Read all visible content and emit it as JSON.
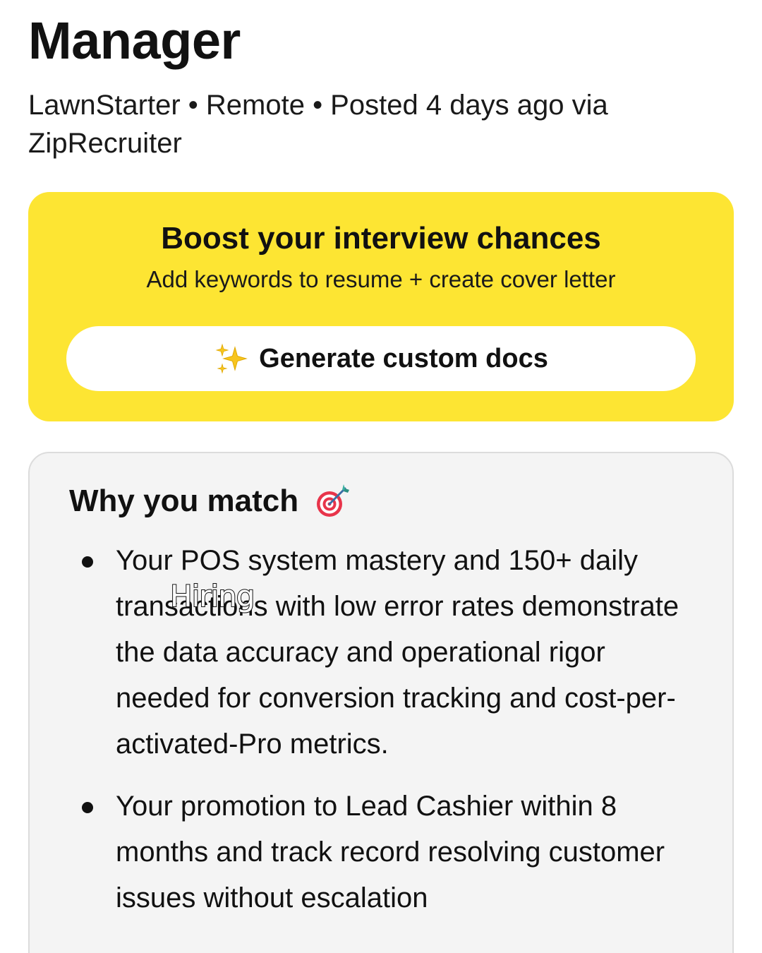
{
  "job": {
    "title": "Manager",
    "meta": "LawnStarter • Remote • Posted 4 days ago via ZipRecruiter"
  },
  "boost_card": {
    "title": "Boost your interview chances",
    "subtitle": "Add keywords to resume + create cover letter",
    "button_label": "Generate custom docs",
    "button_icon": "sparkles-icon",
    "background": "#fde533"
  },
  "match_card": {
    "title": "Why you match",
    "title_icon": "target-icon",
    "items": [
      {
        "text": "Your POS system mastery and 150+ daily transactions with low error rates demonstrate the data accuracy and operational rigor needed for conversion tracking and cost-per-activated-Pro metrics."
      },
      {
        "text": "Your promotion to Lead Cashier within 8 months and track record resolving customer issues without escalation"
      }
    ]
  },
  "overlay": {
    "caption": "Hiring"
  }
}
